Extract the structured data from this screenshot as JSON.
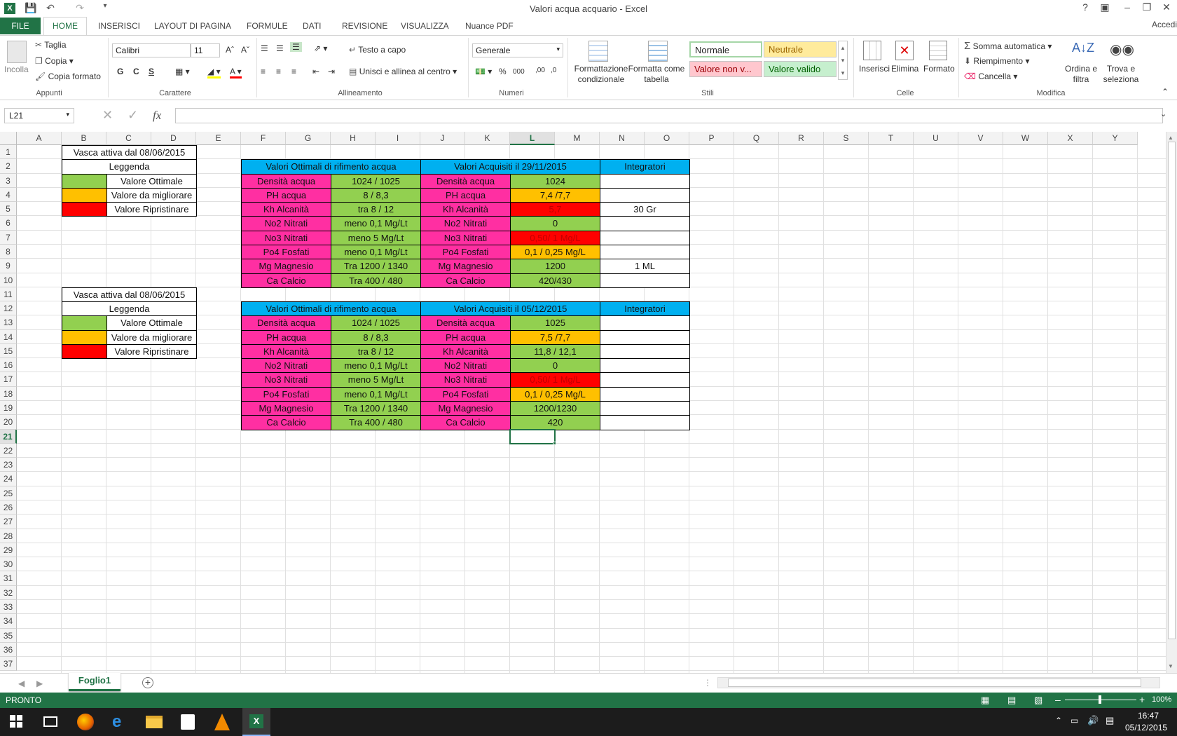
{
  "window": {
    "title": "Valori acqua acquario - Excel",
    "help": "?",
    "signin": "Accedi"
  },
  "tabs": {
    "file": "FILE",
    "home": "HOME",
    "insert": "INSERISCI",
    "layout": "LAYOUT DI PAGINA",
    "formulas": "FORMULE",
    "data": "DATI",
    "review": "REVISIONE",
    "view": "VISUALIZZA",
    "nuance": "Nuance PDF"
  },
  "ribbon": {
    "clipboard": {
      "paste": "Incolla",
      "cut": "Taglia",
      "copy": "Copia",
      "format_painter": "Copia formato",
      "label": "Appunti"
    },
    "font": {
      "name": "Calibri",
      "size": "11",
      "bold": "G",
      "italic": "C",
      "underline": "S",
      "label": "Carattere"
    },
    "alignment": {
      "wrap": "Testo a capo",
      "merge": "Unisci e allinea al centro",
      "label": "Allineamento"
    },
    "number": {
      "format": "Generale",
      "label": "Numeri"
    },
    "styles": {
      "cond_format": "Formattazione condizionale",
      "format_table": "Formatta come tabella",
      "normal": "Normale",
      "neutral": "Neutrale",
      "bad": "Valore non v...",
      "good": "Valore valido",
      "label": "Stili"
    },
    "cells": {
      "insert": "Inserisci",
      "delete": "Elimina",
      "format": "Formato",
      "label": "Celle"
    },
    "editing": {
      "autosum": "Somma automatica",
      "fill": "Riempimento",
      "clear": "Cancella",
      "sort": "Ordina e filtra",
      "find": "Trova e seleziona",
      "label": "Modifica"
    }
  },
  "formula_bar": {
    "name_box": "L21",
    "fx": "fx",
    "value": ""
  },
  "columns": [
    "A",
    "B",
    "C",
    "D",
    "E",
    "F",
    "G",
    "H",
    "I",
    "J",
    "K",
    "L",
    "M",
    "N",
    "O",
    "P",
    "Q",
    "R",
    "S",
    "T",
    "U",
    "V",
    "W",
    "X",
    "Y"
  ],
  "rows": [
    "1",
    "2",
    "3",
    "4",
    "5",
    "6",
    "7",
    "8",
    "9",
    "10",
    "11",
    "12",
    "13",
    "14",
    "15",
    "16",
    "17",
    "18",
    "19",
    "20",
    "21",
    "22",
    "23",
    "24",
    "25",
    "26",
    "27",
    "28",
    "29",
    "30",
    "31",
    "32",
    "33",
    "34",
    "35",
    "36",
    "37"
  ],
  "legend1": {
    "title": "Vasca attiva dal 08/06/2015",
    "header": "Leggenda",
    "items": [
      "Valore Ottimale",
      "Valore da migliorare",
      "Valore Ripristinare"
    ]
  },
  "legend2": {
    "title": "Vasca attiva dal 08/06/2015",
    "header": "Leggenda",
    "items": [
      "Valore Ottimale",
      "Valore da migliorare",
      "Valore Ripristinare"
    ]
  },
  "table1": {
    "header_opt": "Valori Ottimali di rifimento acqua",
    "header_acq": "Valori Acquisiti il  29/11/2015",
    "header_int": "Integratori",
    "rows": [
      {
        "param": "Densità acqua",
        "optimal": "1024 / 1025",
        "param2": "Densità acqua",
        "value": "1024",
        "int": ""
      },
      {
        "param": "PH acqua",
        "optimal": "8 / 8,3",
        "param2": "PH acqua",
        "value": "7,4 /7,7",
        "int": ""
      },
      {
        "param": "Kh Alcanità",
        "optimal": "tra 8 / 12",
        "param2": "Kh Alcanità",
        "value": "5,7",
        "int": "30 Gr"
      },
      {
        "param": "No2 Nitrati",
        "optimal": "meno 0,1 Mg/Lt",
        "param2": "No2 Nitrati",
        "value": "0",
        "int": ""
      },
      {
        "param": "No3 Nitrati",
        "optimal": "meno 5 Mg/Lt",
        "param2": "No3 Nitrati",
        "value": "0,50/ 1 Mg/L",
        "int": ""
      },
      {
        "param": "Po4 Fosfati",
        "optimal": "meno 0,1 Mg/Lt",
        "param2": "Po4 Fosfati",
        "value": "0,1 / 0,25 Mg/L",
        "int": ""
      },
      {
        "param": "Mg Magnesio",
        "optimal": "Tra 1200 / 1340",
        "param2": "Mg Magnesio",
        "value": "1200",
        "int": "1 ML"
      },
      {
        "param": "Ca Calcio",
        "optimal": "Tra 400 / 480",
        "param2": "Ca Calcio",
        "value": "420/430",
        "int": ""
      }
    ]
  },
  "table2": {
    "header_opt": "Valori Ottimali di rifimento acqua",
    "header_acq": "Valori Acquisiti il  05/12/2015",
    "header_int": "Integratori",
    "rows": [
      {
        "param": "Densità acqua",
        "optimal": "1024 / 1025",
        "param2": "Densità acqua",
        "value": "1025",
        "int": ""
      },
      {
        "param": "PH acqua",
        "optimal": "8 / 8,3",
        "param2": "PH acqua",
        "value": "7,5 /7,7",
        "int": ""
      },
      {
        "param": "Kh Alcanità",
        "optimal": "tra 8 / 12",
        "param2": "Kh Alcanità",
        "value": "11,8 / 12,1",
        "int": ""
      },
      {
        "param": "No2 Nitrati",
        "optimal": "meno 0,1 Mg/Lt",
        "param2": "No2 Nitrati",
        "value": "0",
        "int": ""
      },
      {
        "param": "No3 Nitrati",
        "optimal": "meno 5 Mg/Lt",
        "param2": "No3 Nitrati",
        "value": "0,50/ 1 Mg/L",
        "int": ""
      },
      {
        "param": "Po4 Fosfati",
        "optimal": "meno 0,1 Mg/Lt",
        "param2": "Po4 Fosfati",
        "value": "0,1 / 0,25 Mg/L",
        "int": ""
      },
      {
        "param": "Mg Magnesio",
        "optimal": "Tra 1200 / 1340",
        "param2": "Mg Magnesio",
        "value": "1200/1230",
        "int": ""
      },
      {
        "param": "Ca Calcio",
        "optimal": "Tra 400 / 480",
        "param2": "Ca Calcio",
        "value": "420",
        "int": ""
      }
    ]
  },
  "colors": {
    "green": "#92d050",
    "orange": "#ffc000",
    "red": "#ff0000",
    "pink": "#ff2fa2",
    "blue": "#00b0f0",
    "excel": "#217346"
  },
  "sheet": {
    "tab": "Foglio1"
  },
  "status": {
    "mode": "PRONTO",
    "zoom": "100%"
  },
  "taskbar": {
    "time": "16:47",
    "date": "05/12/2015"
  }
}
